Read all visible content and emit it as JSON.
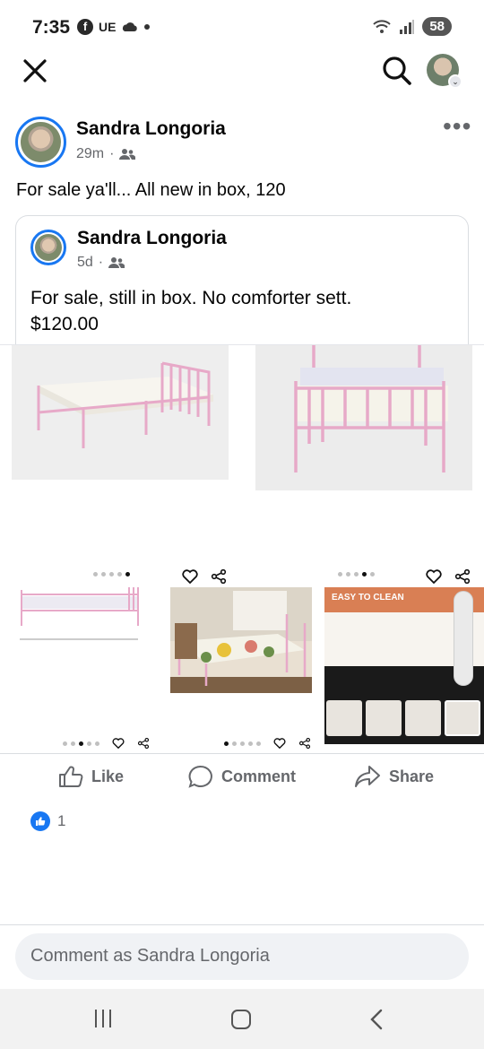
{
  "status": {
    "time": "7:35",
    "left_icons": [
      "facebook-icon",
      "UE",
      "weather-icon"
    ],
    "carrier_tag": "UE",
    "battery": "58",
    "wifi_label": "5"
  },
  "post": {
    "author": "Sandra Longoria",
    "time": "29m",
    "separator": "·",
    "text": "For sale ya'll... All new in box, 120"
  },
  "shared": {
    "author": "Sandra Longoria",
    "time": "5d",
    "separator": "·",
    "line1": "For sale, still in box. No comforter sett.",
    "line2": "$120.00"
  },
  "photos": {
    "p5_banner": "EASY TO CLEAN"
  },
  "actions": {
    "like": "Like",
    "comment": "Comment",
    "share": "Share"
  },
  "reactions": {
    "count": "1"
  },
  "comment_input": {
    "placeholder": "Comment as Sandra Longoria"
  },
  "colors": {
    "accent": "#1877f2",
    "muted": "#65676b",
    "bed_pink": "#e7a9c8"
  }
}
